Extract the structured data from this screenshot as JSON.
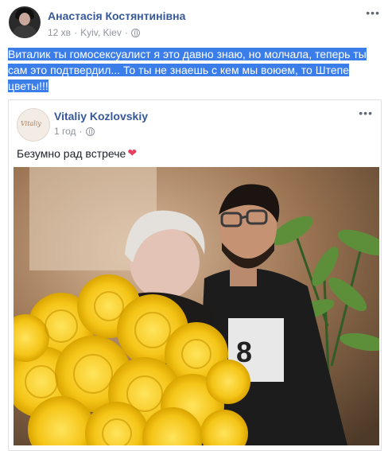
{
  "post": {
    "author": "Анастасія Костянтинівна",
    "time": "12 хв",
    "location": "Kyiv, Kiev",
    "more_label": "•••",
    "text": "Виталик ты гомосексуалист я это давно знаю, но молчала, теперь ты сам это подтвердил... То ты не знаешь с кем мы воюем, то Штепе цветы!!!"
  },
  "shared": {
    "author": "Vitaliy Kozlovskiy",
    "time": "1 год",
    "more_label": "•••",
    "text": "Безумно рад встрече",
    "heart": "❤"
  },
  "icons": {
    "globe": "globe-icon",
    "heart": "heart-emoji"
  },
  "colors": {
    "link": "#365899",
    "highlight": "#3b7de9",
    "meta": "#90949c",
    "flowers": "#f5c518"
  }
}
